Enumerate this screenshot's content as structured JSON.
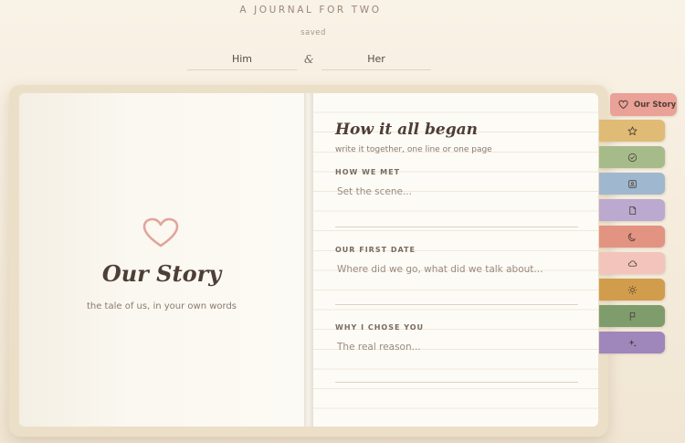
{
  "header": {
    "app_title": "A JOURNAL FOR TWO",
    "save_status": "saved",
    "partner_one_placeholder": "Him",
    "ampersand": "&",
    "partner_two_placeholder": "Her"
  },
  "cover": {
    "icon": "heart-outline-icon",
    "title": "Our Story",
    "subtitle": "the tale of us, in your own words"
  },
  "section": {
    "title": "How it all began",
    "hint": "write it together, one line or one page",
    "prompts": [
      {
        "label": "HOW WE MET",
        "placeholder": "Set the scene..."
      },
      {
        "label": "OUR FIRST DATE",
        "placeholder": "Where did we go, what did we talk about..."
      },
      {
        "label": "WHY I CHOSE YOU",
        "placeholder": "The real reason..."
      }
    ]
  },
  "tabs": [
    {
      "label": "Our Story",
      "icon": "heart-icon",
      "color": "#eaa197",
      "active": true
    },
    {
      "icon": "star-icon",
      "color": "#e0bb75"
    },
    {
      "icon": "check-circle-icon",
      "color": "#a6bb8a"
    },
    {
      "icon": "photo-frame-icon",
      "color": "#9fb8cf"
    },
    {
      "icon": "page-icon",
      "color": "#bba9cf"
    },
    {
      "icon": "moon-icon",
      "color": "#e39381"
    },
    {
      "icon": "cloud-icon",
      "color": "#f2c4bc"
    },
    {
      "icon": "sun-icon",
      "color": "#d19d4c"
    },
    {
      "icon": "flag-icon",
      "color": "#7f9d6c"
    },
    {
      "icon": "sparkle-icon",
      "color": "#9f86bb"
    }
  ]
}
